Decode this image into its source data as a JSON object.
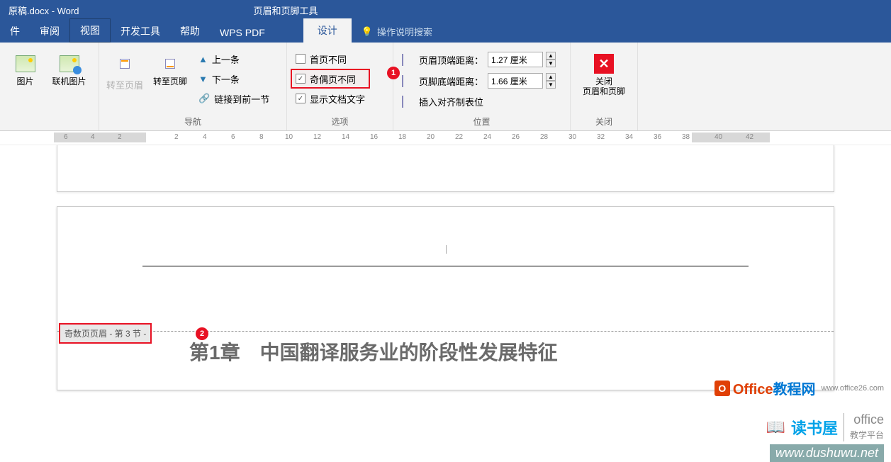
{
  "title": {
    "doc": "原稿.docx",
    "app": "Word",
    "tool_tab": "页眉和页脚工具"
  },
  "tabs": {
    "file": "件",
    "review": "审阅",
    "view": "视图",
    "dev": "开发工具",
    "help": "帮助",
    "wps": "WPS PDF",
    "design": "设计",
    "tellme": "操作说明搜索"
  },
  "ribbon": {
    "insert": {
      "picture": "图片",
      "online": "联机图片"
    },
    "nav": {
      "goto_header": "转至页眉",
      "goto_footer": "转至页脚",
      "prev": "上一条",
      "next": "下一条",
      "link": "链接到前一节",
      "group": "导航"
    },
    "options": {
      "first_diff": "首页不同",
      "odd_even": "奇偶页不同",
      "show_doc": "显示文档文字",
      "group": "选项"
    },
    "position": {
      "header_dist_label": "页眉顶端距离：",
      "header_dist": "1.27 厘米",
      "footer_dist_label": "页脚底端距离：",
      "footer_dist": "1.66 厘米",
      "align_tab": "插入对齐制表位",
      "group": "位置"
    },
    "close": {
      "btn_line1": "关闭",
      "btn_line2": "页眉和页脚",
      "group": "关闭"
    }
  },
  "badges": {
    "b1": "1",
    "b2": "2"
  },
  "ruler": {
    "left_marks": [
      "6",
      "4",
      "2"
    ],
    "right_marks": [
      "2",
      "4",
      "6",
      "8",
      "10",
      "12",
      "14",
      "16",
      "18",
      "20",
      "22",
      "24",
      "26",
      "28",
      "30",
      "32",
      "34",
      "36",
      "38",
      "40",
      "42"
    ]
  },
  "doc": {
    "header_tag": "奇数页页眉 - 第 3 节 -",
    "chapter": "第1章　中国翻译服务业的阶段性发展特征"
  },
  "watermarks": {
    "dsw_name": "读书屋",
    "dsw_office1": "office",
    "dsw_office2": "教学平台",
    "dsw_url": "www.dushuwu.net",
    "o26_name": "Office教程网",
    "o26_url": "www.office26.com"
  }
}
